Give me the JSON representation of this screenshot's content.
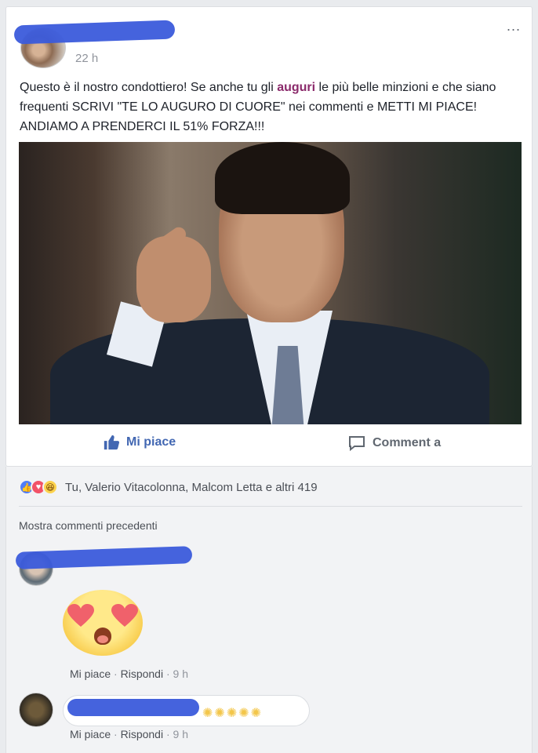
{
  "post": {
    "time": "22 h",
    "more_label": "...",
    "text_before": "Questo è il nostro condottiero! Se anche tu gli ",
    "text_highlight": "auguri",
    "text_after": " le più belle minzioni e che siano frequenti SCRIVI \"TE LO AUGURO DI CUORE\" nei commenti e METTI MI PIACE! ANDIAMO A PRENDERCI IL 51% FORZA!!!"
  },
  "actions": {
    "like_label": "Mi piace",
    "comment_label": "Comment a"
  },
  "reactions": {
    "summary": "Tu, Valerio Vitacolonna, Malcom Letta e altri 419"
  },
  "comments": {
    "show_previous": "Mostra commenti precedenti",
    "items": [
      {
        "like": "Mi piace",
        "dot": " · ",
        "reply": "Rispondi",
        "time": " · 9 h"
      },
      {
        "like": "Mi piace",
        "dot": " · ",
        "reply": "Rispondi",
        "time": " · 9 h",
        "stars": "✺✺✺✺✺"
      }
    ]
  },
  "colors": {
    "accent": "#4267b2",
    "redaction": "#3b5bdb",
    "highlight": "#8b2a6b"
  }
}
